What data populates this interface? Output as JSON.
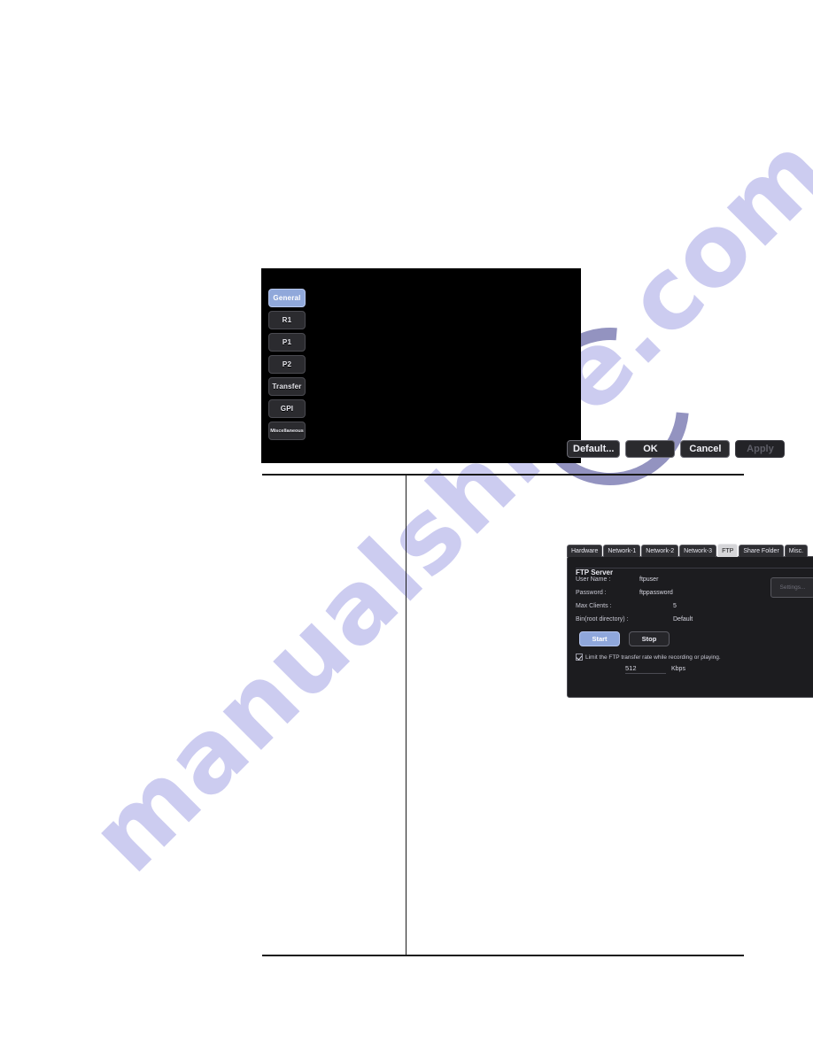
{
  "dialog": {
    "sidebar": {
      "items": [
        {
          "label": "General",
          "selected": true
        },
        {
          "label": "R1",
          "selected": false
        },
        {
          "label": "P1",
          "selected": false
        },
        {
          "label": "P2",
          "selected": false
        },
        {
          "label": "Transfer",
          "selected": false
        },
        {
          "label": "GPI",
          "selected": false
        },
        {
          "label": "Miscellaneous",
          "selected": false
        }
      ]
    },
    "tabs": [
      {
        "label": "Hardware",
        "active": false
      },
      {
        "label": "Network-1",
        "active": false
      },
      {
        "label": "Network-2",
        "active": false
      },
      {
        "label": "Network-3",
        "active": false
      },
      {
        "label": "FTP",
        "active": true
      },
      {
        "label": "Share Folder",
        "active": false
      },
      {
        "label": "Misc.",
        "active": false
      }
    ],
    "ftp_server": {
      "group_title": "FTP Server",
      "fields": [
        {
          "label": "User Name :",
          "value": "ftpuser"
        },
        {
          "label": "Password :",
          "value": "ftppassword"
        },
        {
          "label": "Max Clients :",
          "value": "5"
        },
        {
          "label": "Bin(root directory) :",
          "value": "Default"
        }
      ],
      "settings_button": "Settings...",
      "start_button": "Start",
      "stop_button": "Stop",
      "limit_checkbox_label": "Limit the FTP transfer rate while recording or playing.",
      "limit_checked": true,
      "rate_value": "512",
      "rate_unit": "Kbps"
    },
    "footer": {
      "default_label": "Default...",
      "ok_label": "OK",
      "cancel_label": "Cancel",
      "apply_label": "Apply",
      "apply_disabled": true
    },
    "scrollbar": {
      "up_arrow": "scroll-up",
      "down_arrow": "scroll-down"
    },
    "colors": {
      "accent_blue": "#8fa7db",
      "panel_bg": "#1c1c1f",
      "frame_bg": "#000000",
      "active_tab_bg": "#d5d5d8"
    }
  },
  "watermark": {
    "text": "manualshive.com"
  }
}
